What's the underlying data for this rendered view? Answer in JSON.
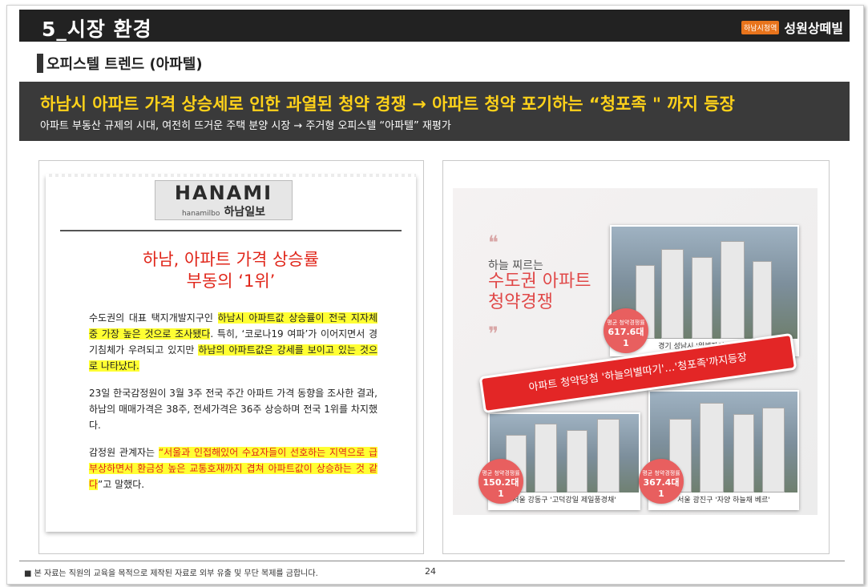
{
  "header": {
    "title": "5_시장 환경",
    "brand_tag": "하남시청역",
    "brand_name": "성원상떼빌"
  },
  "section": {
    "subtitle": "오피스텔 트렌드 (아파텔)"
  },
  "banner": {
    "headline": "하남시 아파트 가격 상승세로 인한 과열된 청약 경쟁 → 아파트 청약 포기하는 “청포족 \" 까지 등장",
    "subline": "아파트 부동산 규제의 시대, 여전히 뜨거운 주택 분양 시장 → 주거형 오피스텔 “아파텔” 재평가"
  },
  "article": {
    "logo_main": "HANAMI",
    "logo_small": "hanamilbo",
    "logo_korean": "하남일보",
    "title_line1": "하남, 아파트 가격 상승률",
    "title_line2": "부동의 ‘1위’",
    "p1_a": "수도권의 대표 택지개발지구인 ",
    "p1_hl1": "하남시 아파트값 상승률이 전국 지자체 중 가장 높은 것으로 조사됐다",
    "p1_b": ". 특히, ‘코로나19 여파’가 이어지면서 경기침체가 우려되고 있지만 ",
    "p1_hl2": "하남의 아파트값은 강세를 보이고 있는 것으로 나타났다.",
    "p2": "23일 한국감정원이 3월 3주 전국 주간 아파트 가격 동향을 조사한 결과, 하남의 매매가격은 38주, 전세가격은 36주 상승하며 전국 1위를 차지했다.",
    "p3_a": "감정원 관계자는 ",
    "p3_hl": "“서울과 인접해있어 수요자들이 선호하는 지역으로 급부상하면서 환금성 높은 교통호재까지 겹쳐 아파트값이 상승하는 것 같다",
    "p3_b": "”고 말했다."
  },
  "photo": {
    "small_text": "하늘 찌르는",
    "big_line1": "수도권 아파트",
    "big_line2": "청약경쟁",
    "ribbon": "아파트 청약당첨 '하늘의별따기'…'청포족'까지등장",
    "items": [
      {
        "caption": "경기 성남시 '위례자이 더 시티'",
        "badge_label": "평균 청약경쟁률",
        "badge_value": "617.6대 1",
        "credit": "출처 : GS건설"
      },
      {
        "caption": "서울 강동구 '고덕강일 제일풍경채'",
        "badge_label": "평균 청약경쟁률",
        "badge_value": "150.2대 1",
        "credit": "출처 : 제일건설"
      },
      {
        "caption": "서울 광진구 '자양 하늘채 베르'",
        "badge_label": "평균 청약경쟁률",
        "badge_value": "367.4대 1",
        "credit": "출처 : 코오롱글로벌"
      }
    ]
  },
  "footer": {
    "notice": "■ 본 자료는 직원의 교육을 목적으로 제작된 자료로 외부 유출 및 무단 복제를 금합니다.",
    "page": "24"
  }
}
